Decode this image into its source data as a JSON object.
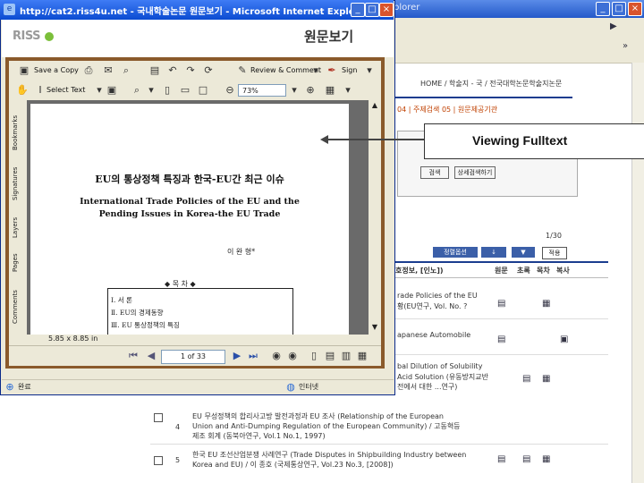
{
  "background_browser": {
    "title_fragment": "plorer",
    "breadcrumb": "HOME / 학술지 - 국 / 전국대학논문학술지논문",
    "tabs_row": "04 | 주제검색   05 | 원문제공기관",
    "search_btn": "검색",
    "detail_search_btn": "상세검색하기",
    "result_count": "1/30",
    "sort_select": "정렬옵션",
    "order_select": "↓",
    "apply_btn": "적용",
    "columns": {
      "left": "호정보, [인노])",
      "download": "원문",
      "abstract": "초록",
      "toc": "목차",
      "copy": "복사"
    },
    "rows": [
      {
        "no": "",
        "title_lines": [
          "rade Policies of the EU",
          "황(EU연구, Vol. No. ?"
        ]
      },
      {
        "no": "",
        "title_lines": [
          "apanese Automobile"
        ]
      },
      {
        "no": "",
        "title_lines": [
          "bal Dilution of Solubility",
          "Acid Solution (유동방지교반",
          "전에서 대한 ...연구)"
        ]
      },
      {
        "no": "4",
        "title_lines": [
          "EU 무성정책의 합리사고방 발전과정과 EU 조사 (Relationship of the European",
          "Union and Anti-Dumping Regulation of the European Community) / 고동혁등",
          "제조 회계 (동북아연구, Vol.1 No.1, 1997)"
        ]
      },
      {
        "no": "5",
        "title_lines": [
          "한국 EU 조선산업분쟁 사례연구 (Trade Disputes in Shipbuilding Industry between",
          "Korea and EU) / 이 종호 (국제통상연구, Vol.23 No.3, [2008])"
        ]
      }
    ],
    "status_zone": "인터넷"
  },
  "popup": {
    "window_title": "http://cat2.riss4u.net - 국내학술논문 원문보기 - Microsoft Internet Explorer",
    "logo": "RISS",
    "heading": "원문보기",
    "statusbar_left": "완료",
    "statusbar_right": "인터넷"
  },
  "pdf_viewer": {
    "toolbar1": {
      "save": "Save a Copy",
      "review": "Review & Comment",
      "sign": "Sign"
    },
    "toolbar2": {
      "select_text": "Select Text",
      "zoom": "73%"
    },
    "side_tabs": [
      "Bookmarks",
      "Signatures",
      "Layers",
      "Pages",
      "Comments"
    ],
    "page_size": "5.85 x 8.85 in",
    "page_indicator": "1 of 33"
  },
  "document": {
    "title_ko": "EU의 통상정책 특징과 한국-EU간 최근 이슈",
    "title_en_1": "International Trade Policies of the EU and the",
    "title_en_2": "Pending Issues in Korea-the EU Trade",
    "author": "이 완 형*",
    "toc_header": "◆ 목 차 ◆",
    "toc": [
      "Ⅰ. 서 론",
      "Ⅱ. EU의 경제동향",
      "Ⅲ. EU 통상정책의 특징"
    ]
  },
  "callout": {
    "label": "Viewing Fulltext"
  }
}
